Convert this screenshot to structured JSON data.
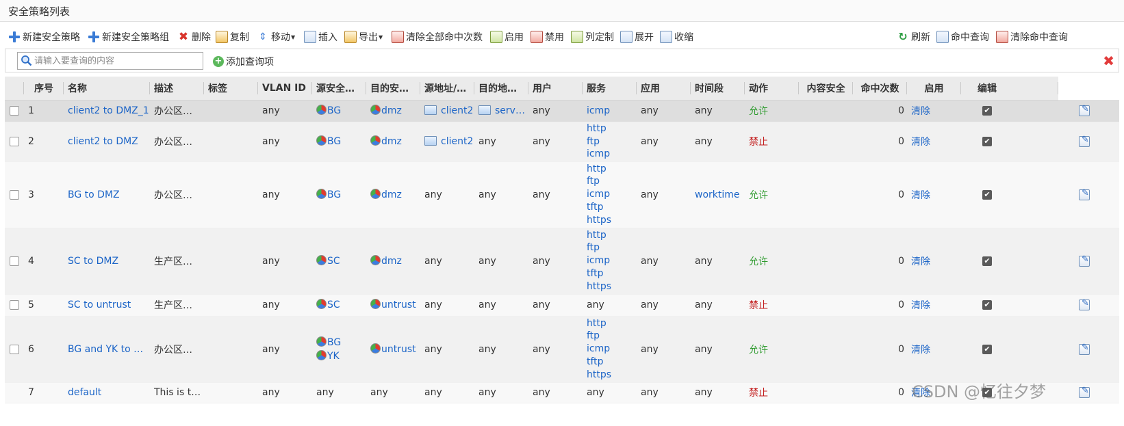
{
  "page": {
    "title": "安全策略列表"
  },
  "toolbar": {
    "new_policy": "新建安全策略",
    "new_policy_group": "新建安全策略组",
    "delete": "删除",
    "copy": "复制",
    "move": "移动",
    "insert": "插入",
    "export": "导出",
    "clear_all_hits": "清除全部命中次数",
    "enable": "启用",
    "disable": "禁用",
    "column_custom": "列定制",
    "expand": "展开",
    "collapse": "收缩",
    "refresh": "刷新",
    "hit_query": "命中查询",
    "clear_hit_query": "清除命中查询"
  },
  "search": {
    "placeholder": "请输入要查询的内容",
    "add_query": "添加查询项"
  },
  "columns": [
    "序号",
    "名称",
    "描述",
    "标签",
    "VLAN ID",
    "源安全…",
    "目的安…",
    "源地址/…",
    "目的地…",
    "用户",
    "服务",
    "应用",
    "时间段",
    "动作",
    "内容安全",
    "命中次数",
    "启用",
    "编辑"
  ],
  "rows": [
    {
      "num": "1",
      "name": "client2 to DMZ_1",
      "desc": "办公区…",
      "tag": "",
      "vlan": "any",
      "src_zone": [
        "BG"
      ],
      "dst_zone": [
        "dmz"
      ],
      "src_addr": "client2",
      "src_addr_icon": true,
      "dst_addr": "serv…",
      "dst_addr_icon": true,
      "user": "any",
      "service": [
        "icmp"
      ],
      "app": "any",
      "time": "any",
      "action": "允许",
      "action_type": "allow",
      "content": "",
      "hits": "0",
      "clear": "清除",
      "enabled": true,
      "selected": true
    },
    {
      "num": "2",
      "name": "client2 to DMZ",
      "desc": "办公区…",
      "tag": "",
      "vlan": "any",
      "src_zone": [
        "BG"
      ],
      "dst_zone": [
        "dmz"
      ],
      "src_addr": "client2",
      "src_addr_icon": true,
      "dst_addr": "any",
      "dst_addr_icon": false,
      "user": "any",
      "service": [
        "http",
        "ftp",
        "icmp"
      ],
      "app": "any",
      "time": "any",
      "action": "禁止",
      "action_type": "deny",
      "content": "",
      "hits": "0",
      "clear": "清除",
      "enabled": true
    },
    {
      "num": "3",
      "name": "BG to DMZ",
      "desc": "办公区…",
      "tag": "",
      "vlan": "any",
      "src_zone": [
        "BG"
      ],
      "dst_zone": [
        "dmz"
      ],
      "src_addr": "any",
      "src_addr_icon": false,
      "dst_addr": "any",
      "dst_addr_icon": false,
      "user": "any",
      "service": [
        "http",
        "ftp",
        "icmp",
        "tftp",
        "https"
      ],
      "app": "any",
      "time": "worktime",
      "time_link": true,
      "action": "允许",
      "action_type": "allow",
      "content": "",
      "hits": "0",
      "clear": "清除",
      "enabled": true
    },
    {
      "num": "4",
      "name": "SC to DMZ",
      "desc": "生产区…",
      "tag": "",
      "vlan": "any",
      "src_zone": [
        "SC"
      ],
      "dst_zone": [
        "dmz"
      ],
      "src_addr": "any",
      "src_addr_icon": false,
      "dst_addr": "any",
      "dst_addr_icon": false,
      "user": "any",
      "service": [
        "http",
        "ftp",
        "icmp",
        "tftp",
        "https"
      ],
      "app": "any",
      "time": "any",
      "action": "允许",
      "action_type": "allow",
      "content": "",
      "hits": "0",
      "clear": "清除",
      "enabled": true
    },
    {
      "num": "5",
      "name": "SC to untrust",
      "desc": "生产区…",
      "tag": "",
      "vlan": "any",
      "src_zone": [
        "SC"
      ],
      "dst_zone": [
        "untrust"
      ],
      "src_addr": "any",
      "src_addr_icon": false,
      "dst_addr": "any",
      "dst_addr_icon": false,
      "user": "any",
      "service_plain": "any",
      "app": "any",
      "time": "any",
      "action": "禁止",
      "action_type": "deny",
      "content": "",
      "hits": "0",
      "clear": "清除",
      "enabled": true
    },
    {
      "num": "6",
      "name": "BG and YK to …",
      "desc": "办公区…",
      "tag": "",
      "vlan": "any",
      "src_zone": [
        "BG",
        "YK"
      ],
      "dst_zone": [
        "untrust"
      ],
      "src_addr": "any",
      "src_addr_icon": false,
      "dst_addr": "any",
      "dst_addr_icon": false,
      "user": "any",
      "service": [
        "http",
        "ftp",
        "icmp",
        "tftp",
        "https"
      ],
      "app": "any",
      "time": "any",
      "action": "允许",
      "action_type": "allow",
      "content": "",
      "hits": "0",
      "clear": "清除",
      "enabled": true
    },
    {
      "num": "7",
      "name": "default",
      "desc": "This is t…",
      "tag": "",
      "vlan": "any",
      "src_zone_plain": "any",
      "dst_zone_plain": "any",
      "src_addr": "any",
      "src_addr_icon": false,
      "dst_addr": "any",
      "dst_addr_icon": false,
      "user": "any",
      "service_plain": "any",
      "app": "any",
      "time": "any",
      "action": "禁止",
      "action_type": "deny",
      "content": "",
      "hits": "0",
      "clear": "清除",
      "enabled": true,
      "no_checkbox": true
    }
  ],
  "watermark": "CSDN @忆往夕梦"
}
